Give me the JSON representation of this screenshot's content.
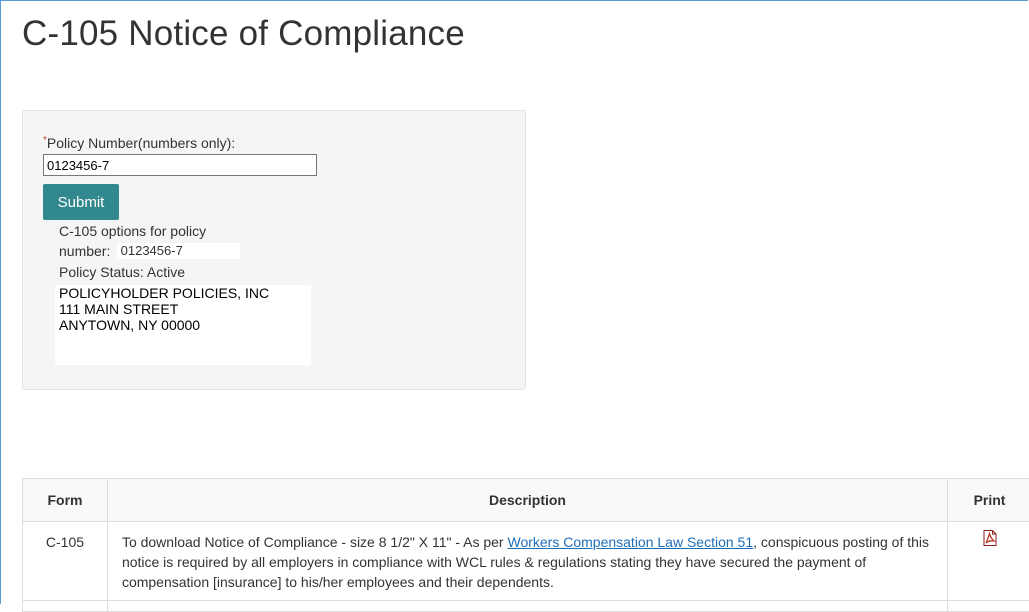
{
  "page": {
    "title": "C-105 Notice of Compliance"
  },
  "form": {
    "required_mark": "*",
    "policy_label": "Policy Number(numbers only):",
    "policy_value": "0123456-7",
    "submit_label": "Submit"
  },
  "result": {
    "options_line1": "C-105 options for policy",
    "options_line2_prefix": "number:",
    "policy_number": "0123456-7",
    "status_text": "Policy Status: Active",
    "address": [
      "POLICYHOLDER POLICIES, INC",
      "111 MAIN STREET",
      "ANYTOWN, NY 00000"
    ]
  },
  "table": {
    "headers": {
      "form": "Form",
      "description": "Description",
      "print": "Print"
    },
    "rows": [
      {
        "form": "C-105",
        "desc_before": "To download Notice of Compliance - size 8 1/2\" X 11\" - As per ",
        "desc_link": "Workers Compensation Law Section 51",
        "desc_after": ", conspicuous posting of this notice is required by all employers in compliance with WCL rules & regulations stating they have secured the payment of compensation [insurance] to his/her employees and their dependents.",
        "print_icon": "pdf-icon"
      }
    ]
  },
  "colors": {
    "submit_bg": "#31888f",
    "link": "#1f6eb8",
    "panel_bg": "#f5f5f5",
    "pdf_red": "#c0392b"
  }
}
